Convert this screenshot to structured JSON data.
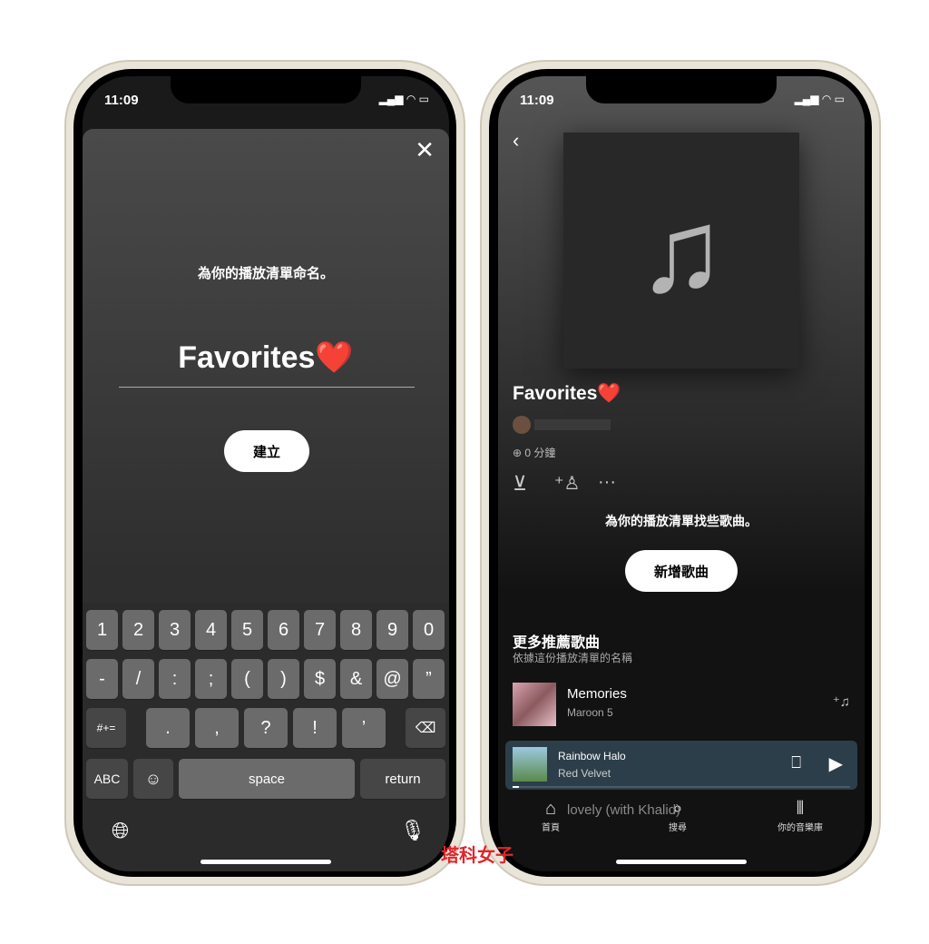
{
  "status": {
    "time": "11:09"
  },
  "left": {
    "prompt": "為你的播放清單命名。",
    "name_value": "Favorites❤️",
    "create_label": "建立",
    "keyboard": {
      "row1": [
        "1",
        "2",
        "3",
        "4",
        "5",
        "6",
        "7",
        "8",
        "9",
        "0"
      ],
      "row2": [
        "-",
        "/",
        ":",
        ";",
        "(",
        ")",
        "$",
        "&",
        "@",
        "”"
      ],
      "row3": [
        "#+=",
        ".",
        ",",
        "?",
        "!",
        "’"
      ],
      "abc": "ABC",
      "space": "space",
      "return": "return"
    }
  },
  "right": {
    "playlist_title": "Favorites❤️",
    "duration": "0 分鐘",
    "empty_prompt": "為你的播放清單找些歌曲。",
    "add_songs_label": "新增歌曲",
    "recommend_title": "更多推薦歌曲",
    "recommend_subtitle": "依據這份播放清單的名稱",
    "tracks": [
      {
        "title": "Memories",
        "artist": "Maroon 5"
      },
      {
        "title": "lovely (with Khalid)",
        "artist": ""
      }
    ],
    "now_playing": {
      "title": "Rainbow Halo",
      "artist": "Red Velvet",
      "progress": 0.02
    },
    "nav": {
      "home": "首頁",
      "search": "搜尋",
      "library": "你的音樂庫"
    }
  },
  "watermark": "塔科女子",
  "colors": {
    "accent": "#1db954",
    "now_playing_bg": "#2c3e4a"
  }
}
